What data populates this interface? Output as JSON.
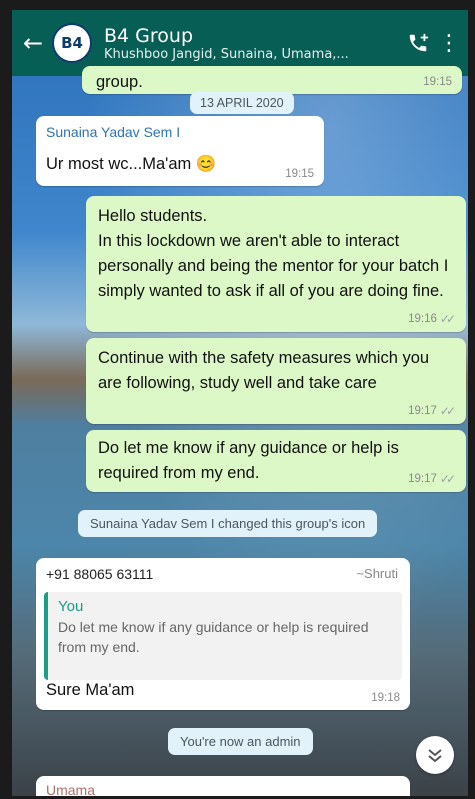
{
  "header": {
    "title": "B4 Group",
    "subtitle": "Khushboo Jangid, Sunaina, Umama,...",
    "avatar_text": "B4"
  },
  "prev_msg": {
    "text": "group.",
    "time": "19:15"
  },
  "date_badge": "13 APRIL 2020",
  "messages": [
    {
      "sender": "Sunaina Yadav Sem I",
      "text": "Ur most wc...Ma'am 😊",
      "time": "19:15"
    },
    {
      "text": "Hello students.\nIn this lockdown we aren't able to interact personally and being the mentor for your batch I simply wanted to ask if all of you are doing fine.",
      "time": "19:16"
    },
    {
      "text": "Continue with the safety measures which you are following, study well and take care",
      "time": "19:17"
    },
    {
      "text": "Do let me know if any guidance or help is required from my end.",
      "time": "19:17"
    }
  ],
  "system_icon_change": "Sunaina Yadav Sem I changed this group's icon",
  "reply": {
    "phone": "+91 88065 63111",
    "name": "~Shruti",
    "quote_author": "You",
    "quote_text": "Do let me know if any guidance or help is required from my end.",
    "text": "Sure Ma'am",
    "time": "19:18"
  },
  "system_admin": "You're now an admin",
  "next_sender": "Umama",
  "colors": {
    "header": "#075E54",
    "outgoing": "#dcf8c6",
    "incoming": "#ffffff",
    "sender": "#2d74b3"
  }
}
